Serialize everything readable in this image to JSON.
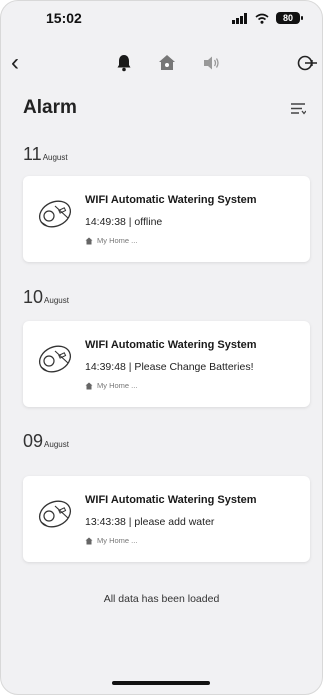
{
  "status_bar": {
    "time": "15:02",
    "battery": "80"
  },
  "header": {
    "title": "Alarm"
  },
  "alarms": [
    {
      "day": "11",
      "month": "August",
      "device": "WIFI Automatic Watering System",
      "detail": "14:49:38 | offline",
      "home": "My Home ..."
    },
    {
      "day": "10",
      "month": "August",
      "device": "WIFI Automatic Watering System",
      "detail": "14:39:48 | Please Change Batteries!",
      "home": "My Home ..."
    },
    {
      "day": "09",
      "month": "August",
      "device": "WIFI Automatic Watering System",
      "detail": "13:43:38 | please add water",
      "home": "My Home ..."
    }
  ],
  "footer": {
    "loaded_text": "All data has been loaded"
  }
}
